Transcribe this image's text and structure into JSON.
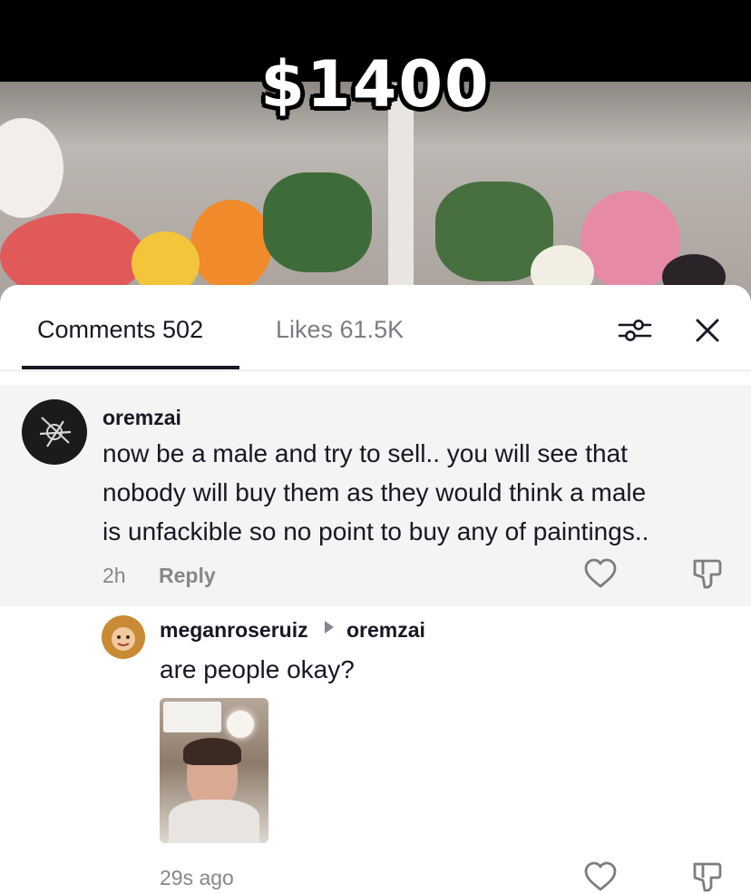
{
  "video": {
    "overlay_text": "$1400"
  },
  "tabs": {
    "comments": "Comments 502",
    "likes": "Likes 61.5K"
  },
  "icons": {
    "filter": "filter-sliders-icon",
    "close": "close-icon",
    "like": "heart-outline-icon",
    "dislike": "thumbs-down-icon"
  },
  "comment": {
    "username": "oremzai",
    "text_lines": [
      "now be a male and try to sell.. you will see that",
      "nobody will buy them as they would think a male",
      "is unfackible so no point to buy any of paintings.."
    ],
    "time": "2h",
    "reply_label": "Reply"
  },
  "reply": {
    "username": "meganroseruiz",
    "replying_to": "oremzai",
    "text": "are people okay?",
    "time": "29s ago"
  },
  "colors": {
    "text_primary": "#161823",
    "text_secondary": "#86878b",
    "highlight_bg": "#f4f4f5",
    "divider": "#e3e3e4"
  }
}
